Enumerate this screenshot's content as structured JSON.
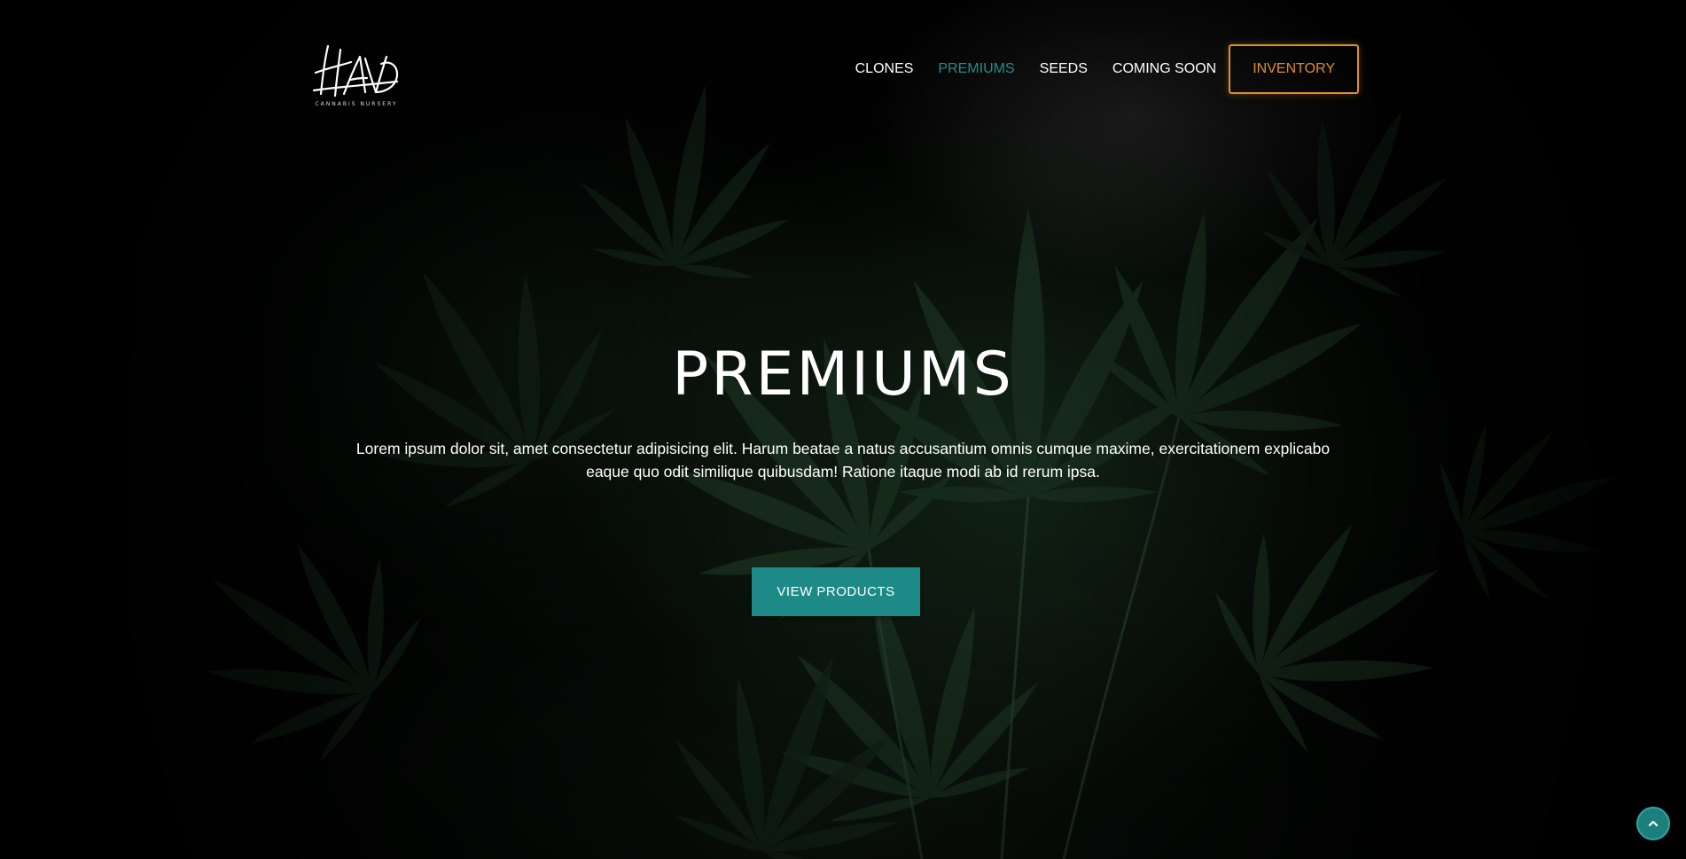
{
  "brand": {
    "logo_text": "HAVA",
    "logo_subtitle": "CANNABIS NURSERY"
  },
  "nav": {
    "items": [
      {
        "label": "CLONES",
        "active": false
      },
      {
        "label": "PREMIUMS",
        "active": true
      },
      {
        "label": "SEEDS",
        "active": false
      },
      {
        "label": "COMING SOON",
        "active": false
      }
    ],
    "inventory_label": "INVENTORY"
  },
  "hero": {
    "title": "PREMIUMS",
    "text": "Lorem ipsum dolor sit, amet consectetur adipisicing elit. Harum beatae a natus accusantium omnis cumque maxime, exercitationem explicabo eaque quo odit similique quibusdam! Ratione itaque modi ab id rerum ipsa.",
    "cta_label": "VIEW PRODUCTS"
  },
  "icons": {
    "scroll_top": "chevron-up-icon",
    "background": "cannabis-leaves-photo"
  },
  "colors": {
    "accent_teal": "#1d8a87",
    "inventory_orange": "#e08e2a",
    "active_nav": "#1f8f8a",
    "background": "#050505"
  }
}
